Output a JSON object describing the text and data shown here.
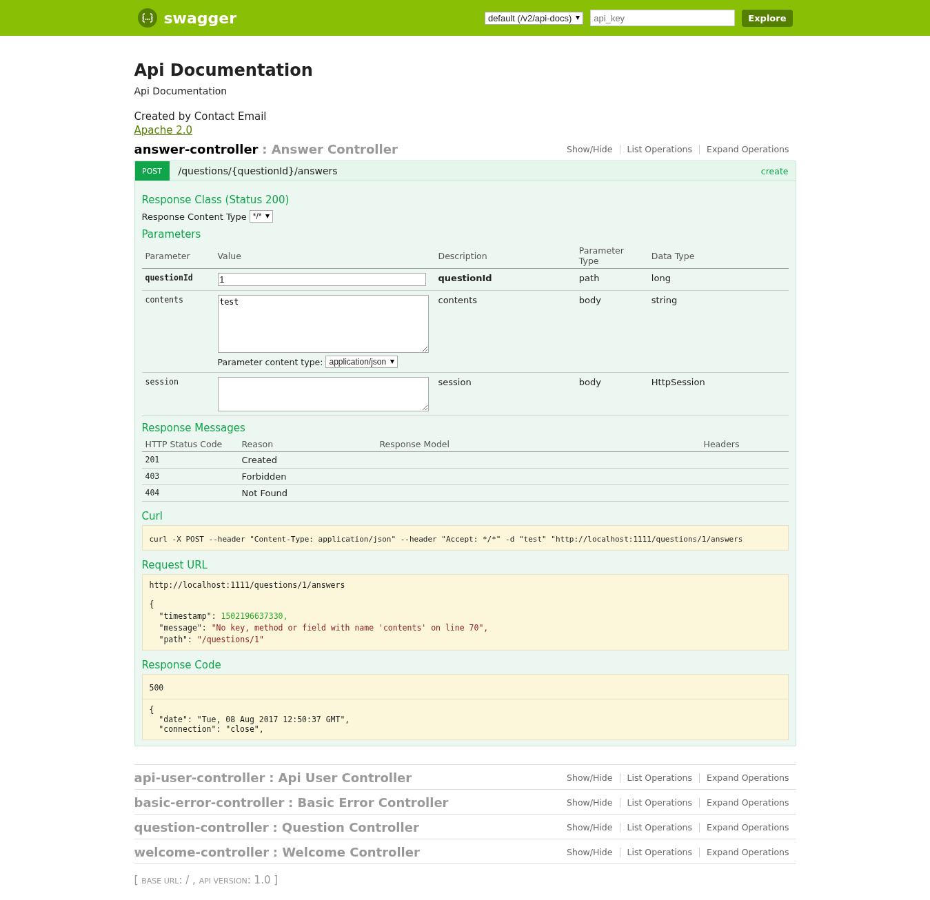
{
  "header": {
    "logo_text": "swagger",
    "spec_select": "default (/v2/api-docs)",
    "api_key_placeholder": "api_key",
    "explore_button": "Explore"
  },
  "info": {
    "title": "Api Documentation",
    "description": "Api Documentation",
    "contact": "Created by Contact Email",
    "license": "Apache 2.0"
  },
  "resources": [
    {
      "name": "answer-controller",
      "description": ": Answer Controller",
      "expanded": true,
      "links": [
        "Show/Hide",
        "List Operations",
        "Expand Operations"
      ],
      "operation": {
        "method": "POST",
        "path": "/questions/{questionId}/answers",
        "summary": "create",
        "response_class_heading": "Response Class (Status 200)",
        "content_type_label": "Response Content Type",
        "content_type_value": "*/*",
        "parameters_heading": "Parameters",
        "param_columns": [
          "Parameter",
          "Value",
          "Description",
          "Parameter Type",
          "Data Type"
        ],
        "params": [
          {
            "name": "questionId",
            "required": true,
            "kind": "input",
            "value": "1",
            "description": "questionId",
            "param_type": "path",
            "data_type": "long"
          },
          {
            "name": "contents",
            "required": false,
            "kind": "textarea",
            "value": "test",
            "description": "contents",
            "param_type": "body",
            "data_type": "string",
            "content_type_label": "Parameter content type:",
            "content_type_value": "application/json"
          },
          {
            "name": "session",
            "required": false,
            "kind": "textarea",
            "description": "session",
            "param_type": "body",
            "data_type": "HttpSession"
          }
        ],
        "response_messages_heading": "Response Messages",
        "response_columns": [
          "HTTP Status Code",
          "Reason",
          "Response Model",
          "Headers"
        ],
        "response_messages": [
          {
            "code": "201",
            "reason": "Created"
          },
          {
            "code": "403",
            "reason": "Forbidden"
          },
          {
            "code": "404",
            "reason": "Not Found"
          }
        ],
        "curl_heading": "Curl",
        "curl": "curl -X POST --header \"Content-Type: application/json\" --header \"Accept: */*\" -d \"test\" \"http://localhost:1111/questions/1/answers",
        "request_url_heading": "Request URL",
        "request_url": "http://localhost:1111/questions/1/answers",
        "response_body": {
          "open": "{",
          "fields": [
            {
              "key": "\"timestamp\":",
              "value": "1502196637330,",
              "kind": "number"
            },
            {
              "key": "\"message\":",
              "value": "\"No key, method or field with name 'contents' on line 70\",",
              "kind": "string"
            },
            {
              "key": "\"path\":",
              "value": "\"/questions/1\"",
              "kind": "string"
            }
          ]
        },
        "response_code_heading": "Response Code",
        "response_code": "500",
        "response_headers": [
          "{",
          "  \"date\": \"Tue, 08 Aug 2017 12:50:37 GMT\",",
          "  \"connection\": \"close\","
        ]
      }
    },
    {
      "name": "api-user-controller",
      "description": ": Api User Controller",
      "expanded": false,
      "links": [
        "Show/Hide",
        "List Operations",
        "Expand Operations"
      ]
    },
    {
      "name": "basic-error-controller",
      "description": ": Basic Error Controller",
      "expanded": false,
      "links": [
        "Show/Hide",
        "List Operations",
        "Expand Operations"
      ]
    },
    {
      "name": "question-controller",
      "description": ": Question Controller",
      "expanded": false,
      "links": [
        "Show/Hide",
        "List Operations",
        "Expand Operations"
      ]
    },
    {
      "name": "welcome-controller",
      "description": ": Welcome Controller",
      "expanded": false,
      "links": [
        "Show/Hide",
        "List Operations",
        "Expand Operations"
      ]
    }
  ],
  "footer": {
    "open": "[",
    "base_url_label": "BASE URL",
    "base_url": ": / ,",
    "api_version_label": "API VERSION",
    "api_version": ": 1.0",
    "close": "]"
  }
}
